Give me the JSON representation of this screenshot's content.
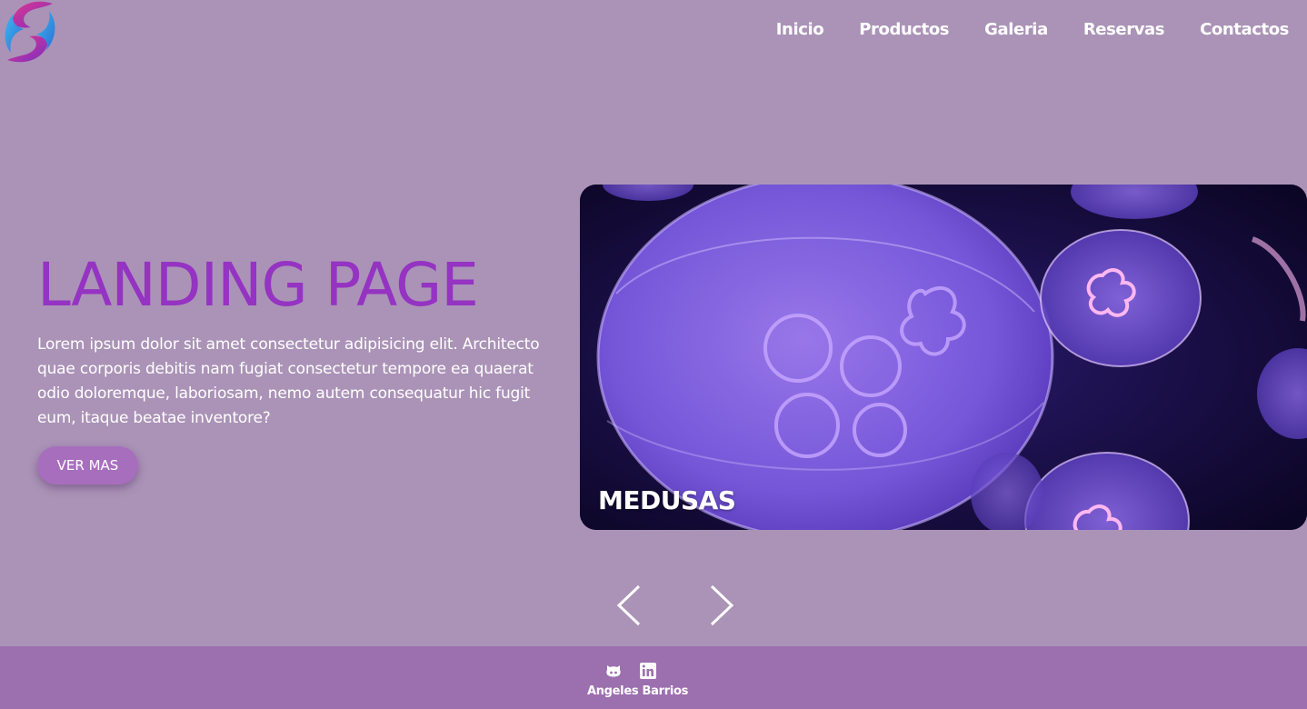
{
  "header": {
    "logo_icon": "swirl-logo-icon",
    "nav": [
      {
        "label": "Inicio"
      },
      {
        "label": "Productos"
      },
      {
        "label": "Galeria"
      },
      {
        "label": "Reservas"
      },
      {
        "label": "Contactos"
      }
    ]
  },
  "hero": {
    "title": "LANDING PAGE",
    "text": "Lorem ipsum dolor sit amet consectetur adipisicing elit. Architecto quae corporis debitis nam fugiat consectetur tempore ea quaerat odio doloremque, laboriosam, nemo autem consequatur hic fugit eum, itaque beatae inventore?",
    "cta_label": "VER MAS"
  },
  "slider": {
    "caption": "MEDUSAS",
    "image_icon": "jellyfish-photo",
    "prev_icon": "chevron-left-icon",
    "next_icon": "chevron-right-icon"
  },
  "footer": {
    "icons": [
      "github-icon",
      "linkedin-icon"
    ],
    "name": "Angeles Barrios"
  },
  "colors": {
    "background": "#ab93b7",
    "title": "#9533c2",
    "button": "#a86ebe",
    "footer": "#9c6faf",
    "text": "#ffffff"
  }
}
